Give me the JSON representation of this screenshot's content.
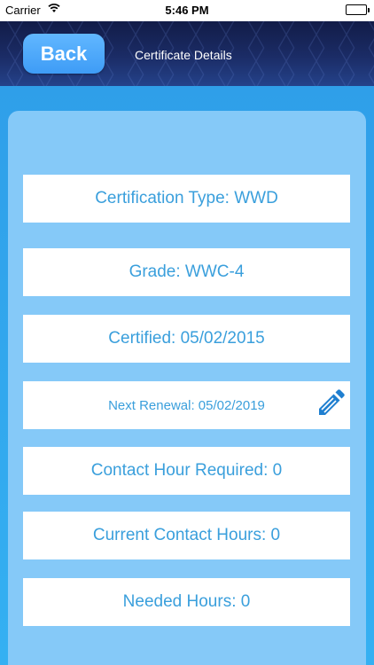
{
  "status": {
    "carrier": "Carrier",
    "time": "5:46 PM"
  },
  "nav": {
    "back_label": "Back",
    "title": "Certificate Details"
  },
  "details": {
    "certification_type": "Certification Type: WWD",
    "grade": "Grade: WWC-4",
    "certified": "Certified: 05/02/2015",
    "next_renewal": "Next Renewal: 05/02/2019",
    "contact_hour_required": "Contact Hour Required: 0",
    "current_contact_hours": "Current Contact Hours: 0",
    "needed_hours": "Needed Hours: 0"
  },
  "colors": {
    "accent": "#3a9fdc",
    "card": "#85c9f8",
    "edit_icon": "#1f7fd0"
  },
  "icons": {
    "edit": "pencil-icon"
  }
}
